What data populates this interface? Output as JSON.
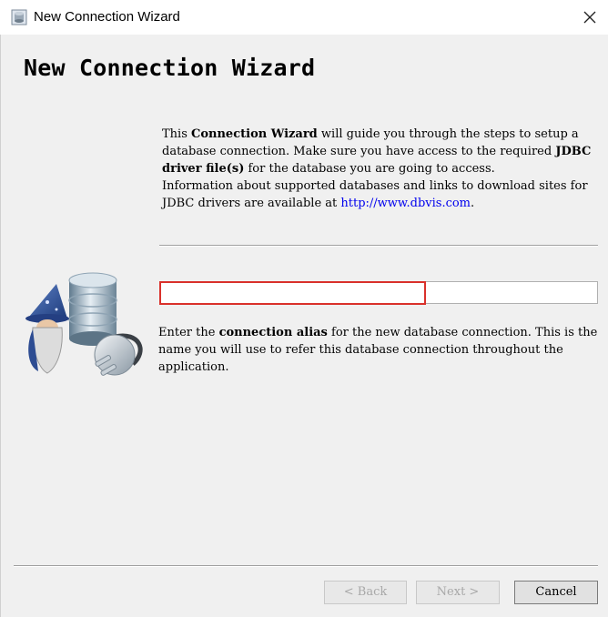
{
  "window": {
    "title": "New Connection Wizard"
  },
  "wizard": {
    "heading": "New Connection Wizard",
    "intro": {
      "p1_before": "This ",
      "p1_bold1": "Connection Wizard",
      "p1_mid": " will guide you through the steps to setup a database connection. Make sure you have access to the required ",
      "p1_bold2": "JDBC driver file(s)",
      "p1_after": " for the database you are going to access.",
      "p2_before": "Information about supported databases and links to download sites for JDBC drivers are available at ",
      "p2_link": "http://www.dbvis.com",
      "p2_after": "."
    },
    "alias_input": {
      "value": "",
      "placeholder": ""
    },
    "help": {
      "before": "Enter the ",
      "bold": "connection alias",
      "after": " for the new database connection. This is the name you will use to refer this database connection throughout the application."
    }
  },
  "buttons": {
    "back": "< Back",
    "next": "Next >",
    "cancel": "Cancel"
  },
  "icons": {
    "app": "database-app-icon",
    "close": "close-icon",
    "wizard": "wizard-database-plug-icon"
  },
  "colors": {
    "content_bg": "#f0f0f0",
    "highlight": "#d9312b",
    "link": "#0000ee"
  }
}
